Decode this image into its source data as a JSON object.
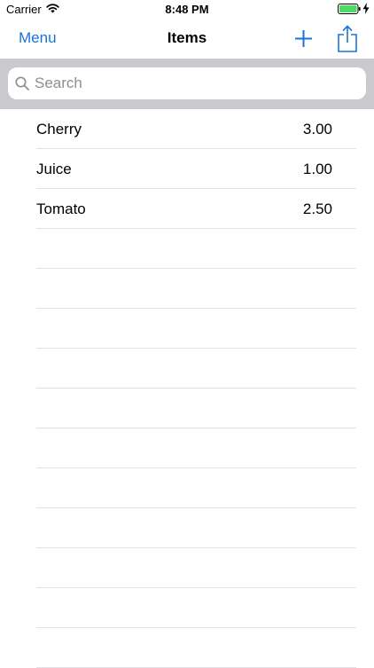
{
  "status_bar": {
    "carrier": "Carrier",
    "time": "8:48 PM",
    "battery_color": "#4cd964"
  },
  "nav": {
    "menu_label": "Menu",
    "title": "Items",
    "accent_color": "#1a73d9",
    "icons": [
      "add-icon",
      "share-icon"
    ]
  },
  "search": {
    "placeholder": "Search",
    "value": ""
  },
  "items": [
    {
      "name": "Cherry",
      "value": "3.00"
    },
    {
      "name": "Juice",
      "value": "1.00"
    },
    {
      "name": "Tomato",
      "value": "2.50"
    },
    {
      "name": "",
      "value": ""
    },
    {
      "name": "",
      "value": ""
    },
    {
      "name": "",
      "value": ""
    },
    {
      "name": "",
      "value": ""
    },
    {
      "name": "",
      "value": ""
    },
    {
      "name": "",
      "value": ""
    },
    {
      "name": "",
      "value": ""
    },
    {
      "name": "",
      "value": ""
    },
    {
      "name": "",
      "value": ""
    },
    {
      "name": "",
      "value": ""
    },
    {
      "name": "",
      "value": ""
    }
  ]
}
